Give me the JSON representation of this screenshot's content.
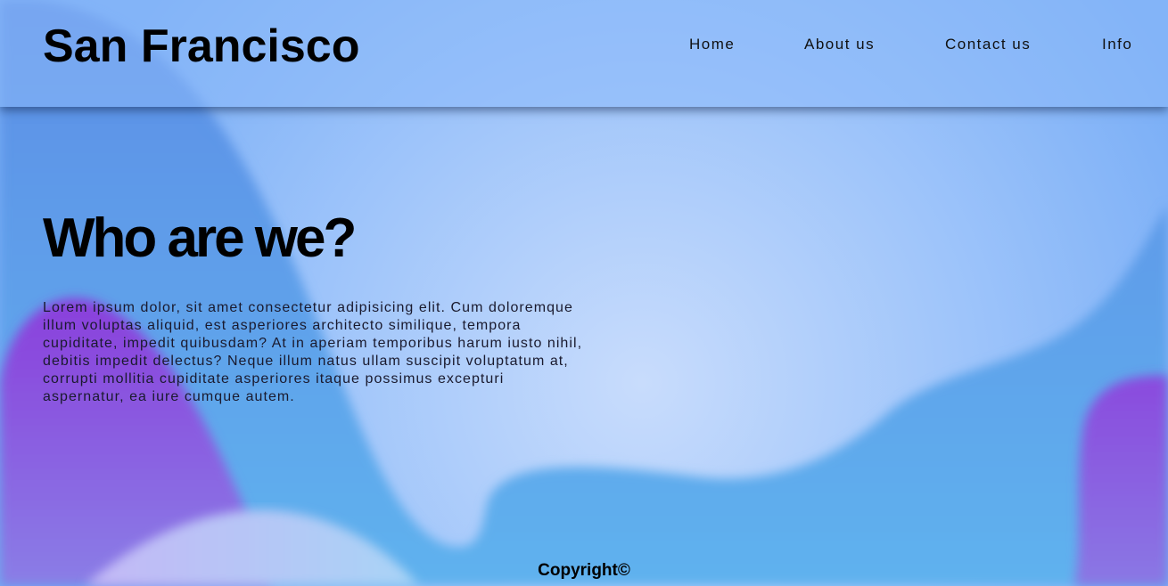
{
  "header": {
    "title": "San Francisco",
    "nav": [
      "Home",
      "About us",
      "Contact us",
      "Info"
    ]
  },
  "main": {
    "heading": "Who are we?",
    "paragraph": "Lorem ipsum dolor, sit amet consectetur adipisicing elit. Cum doloremque illum voluptas aliquid, est asperiores architecto similique, tempora cupiditate, impedit quibusdam? At in aperiam temporibus harum iusto nihil, debitis impedit delectus? Neque illum natus ullam suscipit voluptatum at, corrupti mollitia cupiditate asperiores itaque possimus excepturi aspernatur, ea iure cumque autem."
  },
  "footer": {
    "copyright": "Copyright©"
  },
  "colors": {
    "background_light": "#c4dafc",
    "background_blue": "#7fb2f6",
    "blob_blue": "#5a9eea",
    "blob_purple": "#8a4fe0",
    "text": "#000000"
  }
}
